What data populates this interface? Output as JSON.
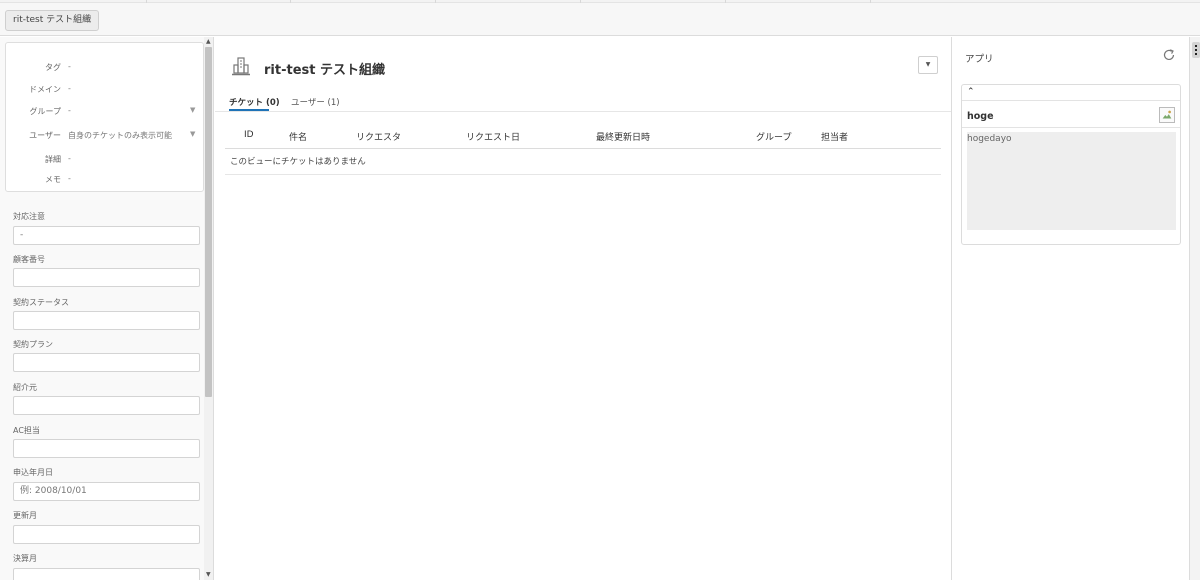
{
  "breadcrumb": {
    "label": "rit-test テスト組織"
  },
  "org_info": {
    "rows": [
      {
        "key": "タグ",
        "value": "-"
      },
      {
        "key": "ドメイン",
        "value": "-"
      },
      {
        "key": "グループ",
        "value": "-"
      },
      {
        "key": "ユーザー",
        "value": "自身のチケットのみ表示可能"
      },
      {
        "key": "詳細",
        "value": "-"
      },
      {
        "key": "メモ",
        "value": "-"
      }
    ]
  },
  "fields": [
    {
      "label": "対応注意",
      "value": "-",
      "placeholder": ""
    },
    {
      "label": "顧客番号",
      "value": "",
      "placeholder": ""
    },
    {
      "label": "契約ステータス",
      "value": "",
      "placeholder": ""
    },
    {
      "label": "契約プラン",
      "value": "",
      "placeholder": ""
    },
    {
      "label": "紹介元",
      "value": "",
      "placeholder": ""
    },
    {
      "label": "AC担当",
      "value": "",
      "placeholder": ""
    },
    {
      "label": "申込年月日",
      "value": "",
      "placeholder": "例: 2008/10/01"
    },
    {
      "label": "更新月",
      "value": "",
      "placeholder": ""
    },
    {
      "label": "決算月",
      "value": "",
      "placeholder": ""
    }
  ],
  "main": {
    "title": "rit-test テスト組織",
    "tabs": [
      {
        "label": "チケット (0)",
        "active": true
      },
      {
        "label": "ユーザー (1)",
        "active": false
      }
    ],
    "table": {
      "columns": [
        "ID",
        "件名",
        "リクエスタ",
        "リクエスト日",
        "最終更新日時",
        "グループ",
        "担当者"
      ],
      "empty_message": "このビューにチケットはありません"
    }
  },
  "apps_panel": {
    "title": "アプリ",
    "app": {
      "name": "hoge",
      "content": "hogedayo"
    }
  },
  "colors": {
    "accent": "#1f73b7"
  }
}
